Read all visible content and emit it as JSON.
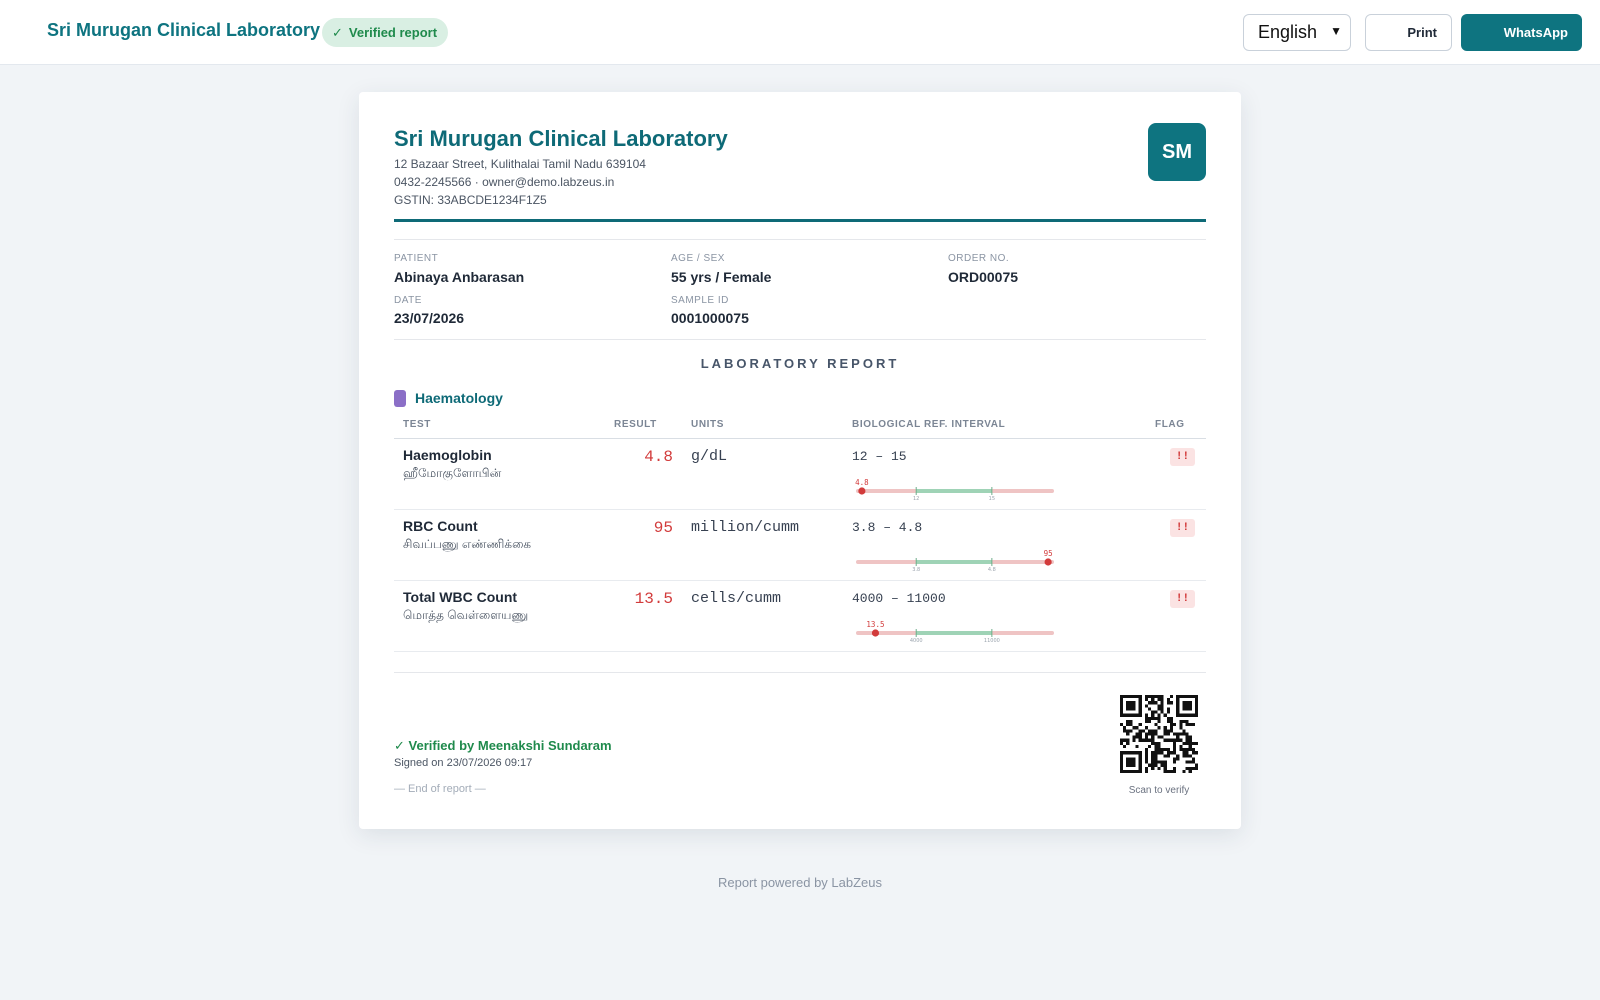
{
  "topbar": {
    "brand": "Sri Murugan Clinical Laboratory",
    "verified_label": "Verified report",
    "language": "English",
    "print_label": "Print",
    "whatsapp_label": "WhatsApp"
  },
  "lab": {
    "name": "Sri Murugan Clinical Laboratory",
    "address": "12 Bazaar Street, Kulithalai Tamil Nadu 639104",
    "contact": "0432-2245566 · owner@demo.labzeus.in",
    "gstin": "GSTIN: 33ABCDE1234F1Z5",
    "initials": "SM",
    "accent_color": "#0e7480"
  },
  "patient": {
    "patient_label": "PATIENT",
    "patient_name": "Abinaya Anbarasan",
    "age_sex_label": "AGE / SEX",
    "age_sex": "55 yrs / Female",
    "order_label": "ORDER NO.",
    "order_no": "ORD00075",
    "date_label": "DATE",
    "date": "23/07/2026",
    "sample_label": "SAMPLE ID",
    "sample_id": "0001000075"
  },
  "report": {
    "title": "LABORATORY REPORT",
    "department": "Haematology",
    "department_color": "#8b6fc7",
    "columns": [
      "TEST",
      "RESULT",
      "UNITS",
      "BIOLOGICAL REF. INTERVAL",
      "FLAG"
    ],
    "rows": [
      {
        "test": "Haemoglobin",
        "test_local": "ஹீமோகுளோபின்",
        "result": "4.8",
        "units": "g/dL",
        "ref_interval": "12 – 15",
        "flag": "!!",
        "gauge": {
          "value": 4.8,
          "low": 12,
          "high": 15,
          "value_label": "4.8",
          "low_label": "12",
          "high_label": "15",
          "marker_fraction": 0.02
        }
      },
      {
        "test": "RBC Count",
        "test_local": "சிவப்பணு எண்ணிக்கை",
        "result": "95",
        "units": "million/cumm",
        "ref_interval": "3.8 – 4.8",
        "flag": "!!",
        "gauge": {
          "value": 95,
          "low": 3.8,
          "high": 4.8,
          "value_label": "95",
          "low_label": "3.8",
          "high_label": "4.8",
          "marker_fraction": 0.98
        }
      },
      {
        "test": "Total WBC Count",
        "test_local": "மொத்த வெள்ளையணு",
        "result": "13.5",
        "units": "cells/cumm",
        "ref_interval": "4000 – 11000",
        "flag": "!!",
        "gauge": {
          "value": 13.5,
          "low": 4000,
          "high": 11000,
          "value_label": "13.5",
          "low_label": "4000",
          "high_label": "11000",
          "marker_fraction": 0.09
        }
      }
    ]
  },
  "footer": {
    "verified_by": "Verified by Meenakshi Sundaram",
    "signed_on": "Signed on 23/07/2026 09:17",
    "end_of_report": "— End of report —",
    "scan_caption": "Scan to verify",
    "powered_by": "Report powered by LabZeus"
  },
  "colors": {
    "flag_red": "#d23b3b",
    "normal_green": "#9fd3b6",
    "out_of_range_pink": "#efc4c4",
    "verified_green": "#1f8a4c"
  }
}
